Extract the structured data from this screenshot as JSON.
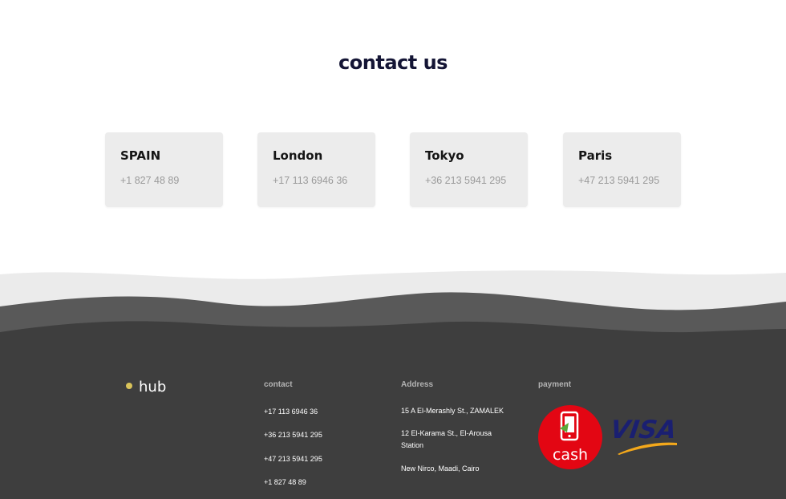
{
  "main": {
    "title": "contact us",
    "offices": [
      {
        "city": "SPAIN",
        "phone": "+1 827 48 89"
      },
      {
        "city": "London",
        "phone": "+17 113 6946 36"
      },
      {
        "city": "Tokyo",
        "phone": "+36 213 5941 295"
      },
      {
        "city": "Paris",
        "phone": "+47 213 5941 295"
      }
    ]
  },
  "footer": {
    "logo": "hub",
    "contact": {
      "heading": "contact",
      "items": [
        "+17 113 6946 36",
        "+36 213 5941 295",
        "+47 213 5941 295",
        "+1 827 48 89"
      ]
    },
    "address": {
      "heading": "Address",
      "items": [
        "15 A El-Merashly St., ZAMALEK",
        "12 El-Karama St., El-Arousa Station",
        "New Nirco, Maadi, Cairo"
      ]
    },
    "payment": {
      "heading": "payment",
      "methods": [
        {
          "label": "cash",
          "icon": "mobile-cash-icon",
          "color": "#e30613"
        },
        {
          "label": "VISA",
          "icon": "visa-logo",
          "color": "#1a1f71"
        }
      ]
    }
  },
  "colors": {
    "title": "#141535",
    "card_bg": "#ececec",
    "footer_bg": "#3e3e3e",
    "accent": "#d9c35a"
  }
}
